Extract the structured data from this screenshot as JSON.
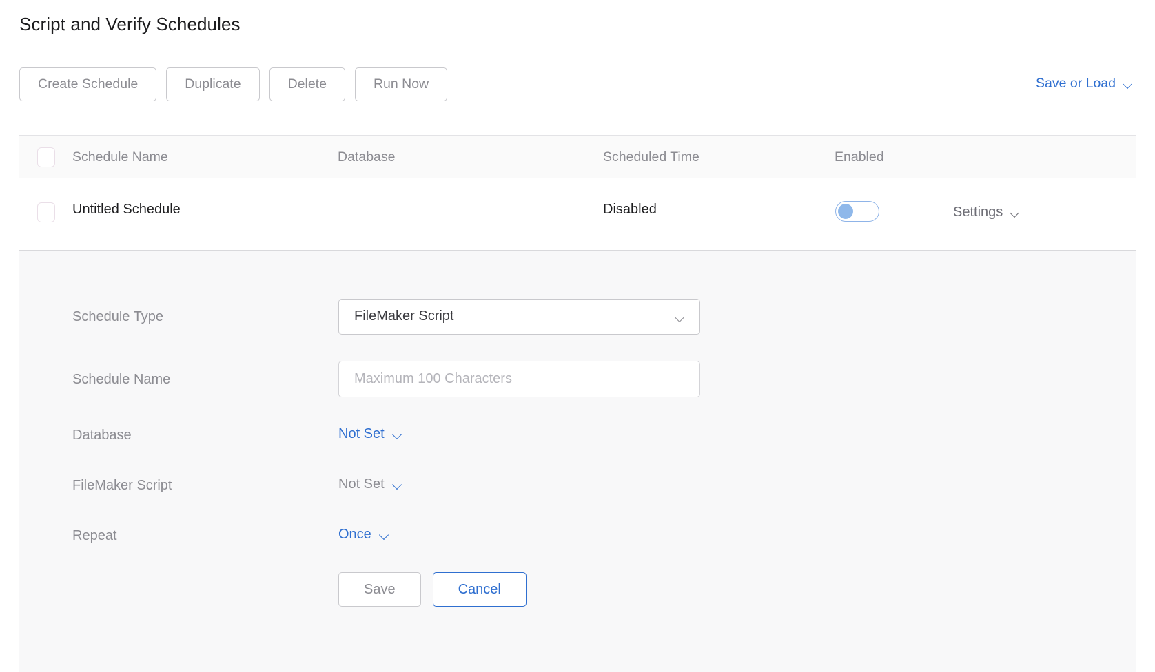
{
  "page": {
    "title": "Script and Verify Schedules"
  },
  "toolbar": {
    "buttons": [
      {
        "label": "Create Schedule"
      },
      {
        "label": "Duplicate"
      },
      {
        "label": "Delete"
      },
      {
        "label": "Run Now"
      }
    ],
    "save_or_load": {
      "label": "Save or Load",
      "icon": "chevron-down-icon"
    }
  },
  "table": {
    "columns": [
      {
        "key": "name",
        "label": "Schedule Name"
      },
      {
        "key": "database",
        "label": "Database"
      },
      {
        "key": "scheduled_time",
        "label": "Scheduled Time"
      },
      {
        "key": "enabled",
        "label": "Enabled"
      }
    ],
    "header_checkbox": {
      "checked": false
    },
    "rows": [
      {
        "checked": false,
        "name": "Untitled Schedule",
        "database": "",
        "scheduled_time": "Disabled",
        "enabled": false,
        "settings_label": "Settings"
      }
    ]
  },
  "detail": {
    "fields": [
      {
        "label": "Schedule Type",
        "control": "select",
        "value": "FileMaker Script"
      },
      {
        "label": "Schedule Name",
        "control": "text",
        "value": "",
        "placeholder": "Maximum 100 Characters"
      },
      {
        "label": "Database",
        "control": "dropdown-link",
        "value": "Not Set",
        "state": "blue"
      },
      {
        "label": "FileMaker Script",
        "control": "dropdown-link",
        "value": "Not Set",
        "state": "muted"
      },
      {
        "label": "Repeat",
        "control": "dropdown-link",
        "value": "Once",
        "state": "blue"
      }
    ],
    "actions": {
      "save_label": "Save",
      "cancel_label": "Cancel"
    }
  },
  "colors": {
    "link_blue": "#2f6fd0",
    "muted_gray": "#8c8c92",
    "text_dark": "#1d1d1f",
    "panel_bg": "#f8f8f9",
    "toggle_knob": "#8fb8ea"
  }
}
